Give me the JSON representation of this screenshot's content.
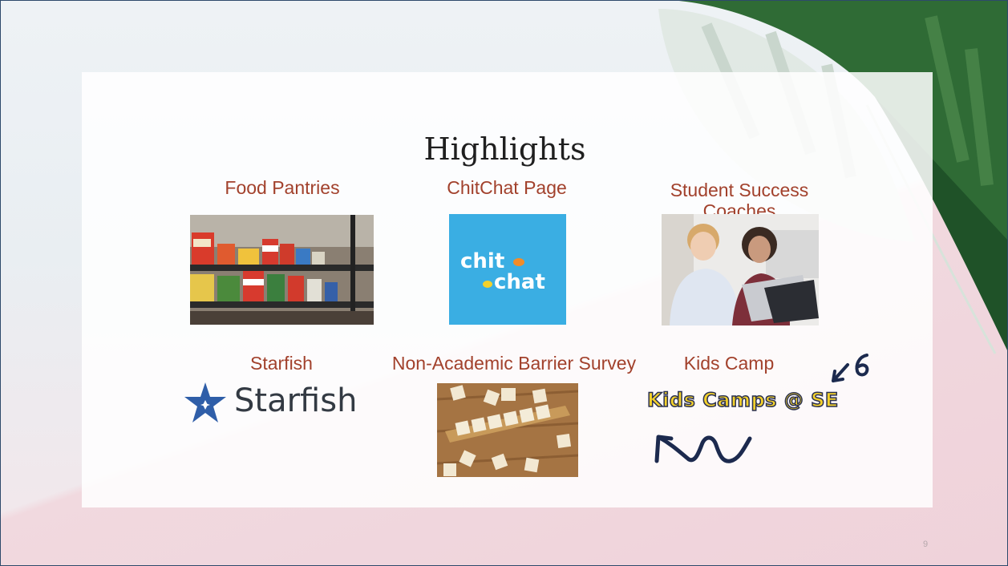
{
  "slide": {
    "title": "Highlights",
    "page_number": "9"
  },
  "items": [
    {
      "heading": "Food Pantries",
      "image": "food-pantry-shelves-photo"
    },
    {
      "heading": "ChitChat Page",
      "image": "chitchat-logo",
      "logo_text_1": "chit",
      "logo_text_2": "chat"
    },
    {
      "heading": "Student Success Coaches",
      "image": "students-laptop-photo"
    },
    {
      "heading": "Starfish",
      "image": "starfish-logo",
      "logo_text": "Starfish"
    },
    {
      "heading": "Non-Academic Barrier Survey",
      "image": "scrabble-survey-photo"
    },
    {
      "heading": "Kids Camp",
      "image": "kids-camps-logo",
      "logo_text": "Kids Camps @ SE"
    }
  ],
  "colors": {
    "heading": "#a2412c",
    "chitchat_bg": "#3aaee3",
    "chitchat_dot": "#f28c28",
    "starfish_blue": "#2f5ea8",
    "kids_yellow": "#f3d12b",
    "doodle_navy": "#1c2a4e"
  }
}
